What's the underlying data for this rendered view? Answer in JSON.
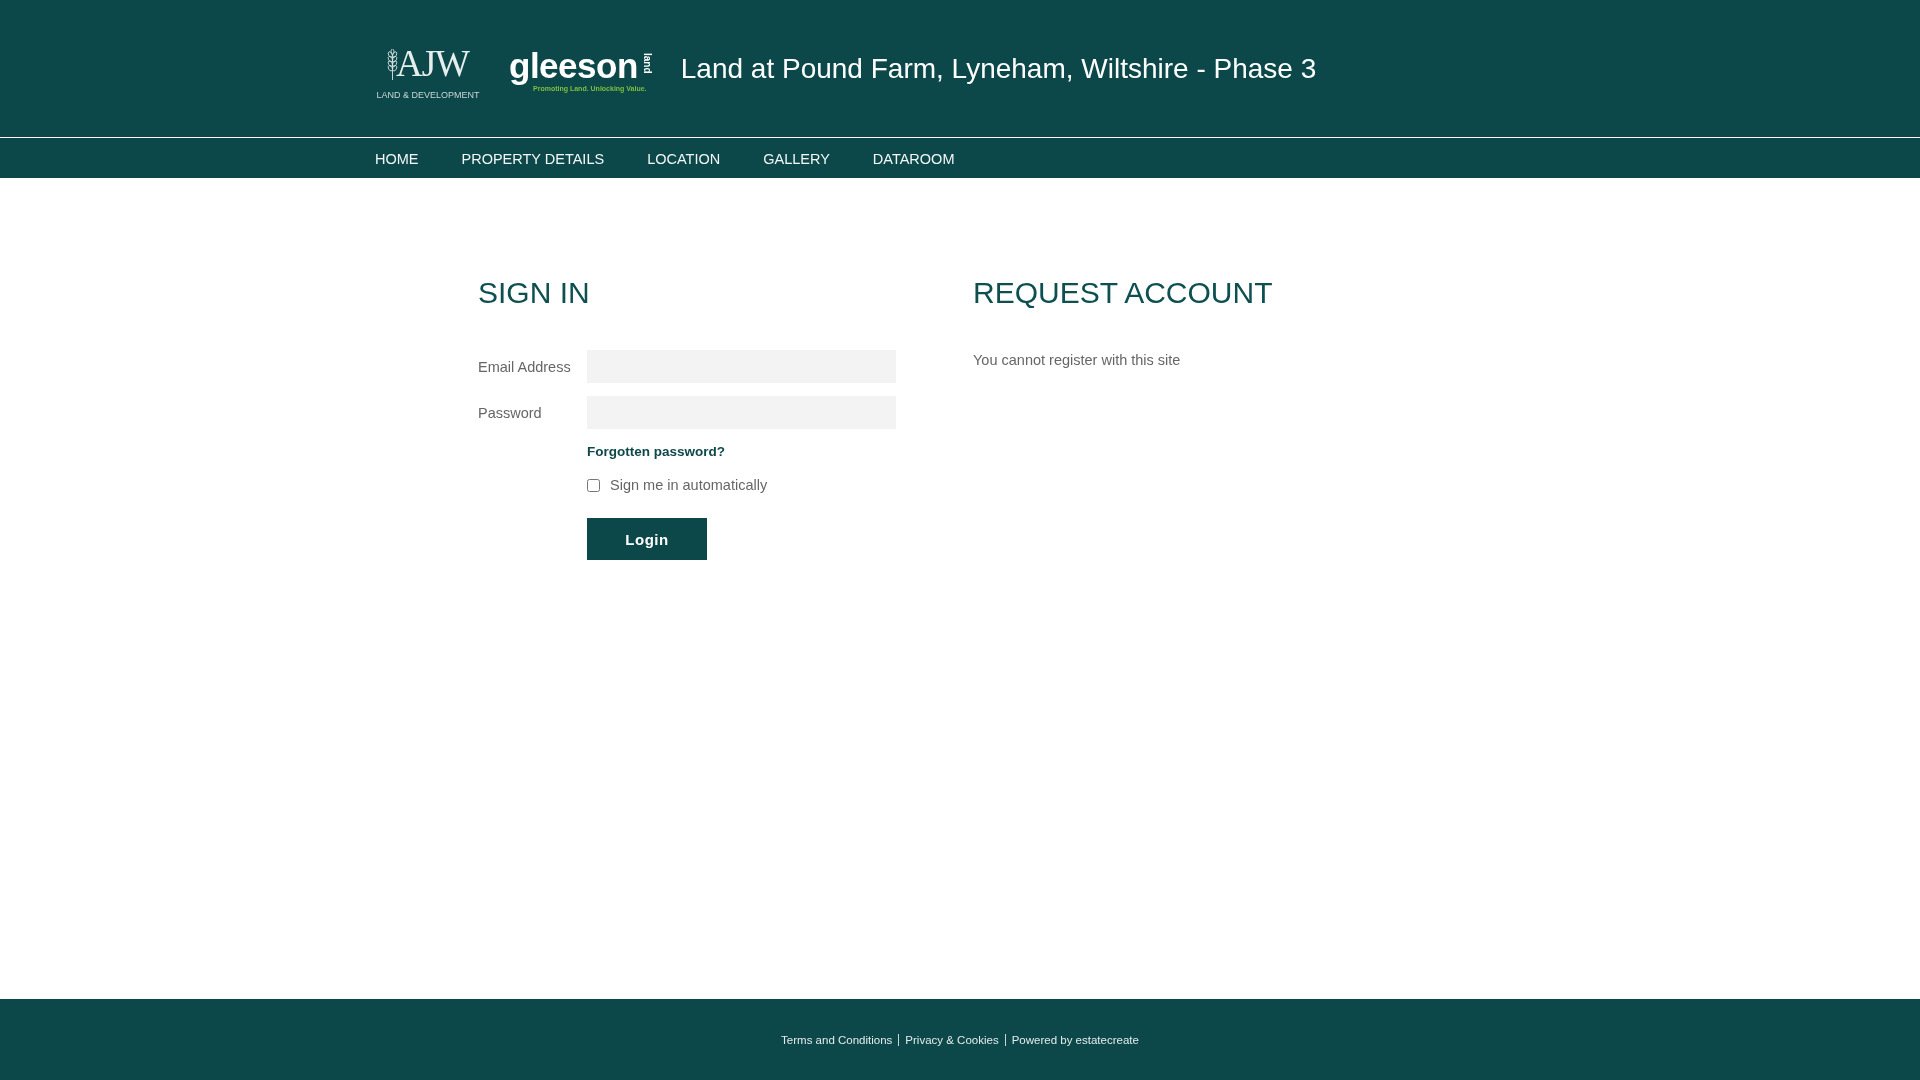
{
  "header": {
    "logos": [
      {
        "kind": "ajw",
        "mark": "AJW",
        "tagline": "LAND & DEVELOPMENT"
      },
      {
        "kind": "gleeson",
        "mark": "gleeson",
        "suffix": "land",
        "tagline": "Promoting Land. Unlocking Value."
      }
    ],
    "title": "Land at Pound Farm, Lyneham, Wiltshire - Phase 3"
  },
  "nav": {
    "items": [
      {
        "label": "HOME"
      },
      {
        "label": "PROPERTY DETAILS"
      },
      {
        "label": "LOCATION"
      },
      {
        "label": "GALLERY"
      },
      {
        "label": "DATAROOM"
      }
    ]
  },
  "sign_in": {
    "title": "SIGN IN",
    "fields": [
      {
        "label": "Email Address"
      },
      {
        "label": "Password"
      }
    ],
    "forgot_link": "Forgotten password?",
    "remember": {
      "label": "Sign me in automatically",
      "checked": false
    },
    "submit": "Login"
  },
  "request_account": {
    "title": "REQUEST ACCOUNT",
    "message": "You cannot register with this site"
  },
  "footer": {
    "links": [
      "Terms and Conditions",
      "Privacy & Cookies",
      "Powered by estatecreate"
    ]
  }
}
